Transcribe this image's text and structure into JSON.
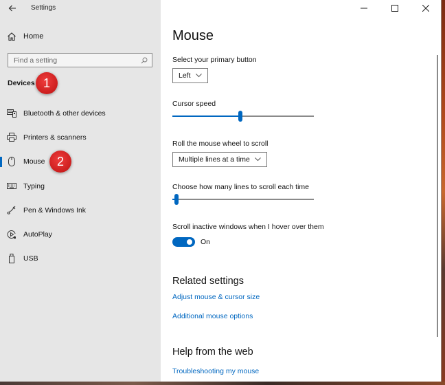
{
  "window": {
    "title": "Settings",
    "controls": [
      "minimize",
      "maximize",
      "close"
    ]
  },
  "sidebar": {
    "back_icon": "back-arrow-icon",
    "home_label": "Home",
    "search_placeholder": "Find a setting",
    "section_title": "Devices",
    "items": [
      {
        "label": "Bluetooth & other devices",
        "icon": "bluetooth-devices-icon",
        "selected": false
      },
      {
        "label": "Printers & scanners",
        "icon": "printer-icon",
        "selected": false
      },
      {
        "label": "Mouse",
        "icon": "mouse-icon",
        "selected": true
      },
      {
        "label": "Typing",
        "icon": "keyboard-icon",
        "selected": false
      },
      {
        "label": "Pen & Windows Ink",
        "icon": "pen-icon",
        "selected": false
      },
      {
        "label": "AutoPlay",
        "icon": "autoplay-icon",
        "selected": false
      },
      {
        "label": "USB",
        "icon": "usb-icon",
        "selected": false
      }
    ]
  },
  "annotations": [
    {
      "label": "1",
      "color": "#d92626"
    },
    {
      "label": "2",
      "color": "#d92626"
    }
  ],
  "main": {
    "title": "Mouse",
    "primary_button": {
      "label": "Select your primary button",
      "value": "Left"
    },
    "cursor_speed": {
      "label": "Cursor speed",
      "value_fraction": 0.48
    },
    "wheel_scroll": {
      "label": "Roll the mouse wheel to scroll",
      "value": "Multiple lines at a time"
    },
    "lines_to_scroll": {
      "label": "Choose how many lines to scroll each time",
      "value_fraction": 0.03
    },
    "scroll_inactive": {
      "label": "Scroll inactive windows when I hover over them",
      "state": "On",
      "on": true
    },
    "related": {
      "title": "Related settings",
      "links": [
        "Adjust mouse & cursor size",
        "Additional mouse options"
      ]
    },
    "help": {
      "title": "Help from the web",
      "links": [
        "Troubleshooting my mouse"
      ]
    }
  },
  "colors": {
    "accent": "#0067c0",
    "sidebar_bg": "#e6e6e6",
    "badge": "#d92626"
  }
}
